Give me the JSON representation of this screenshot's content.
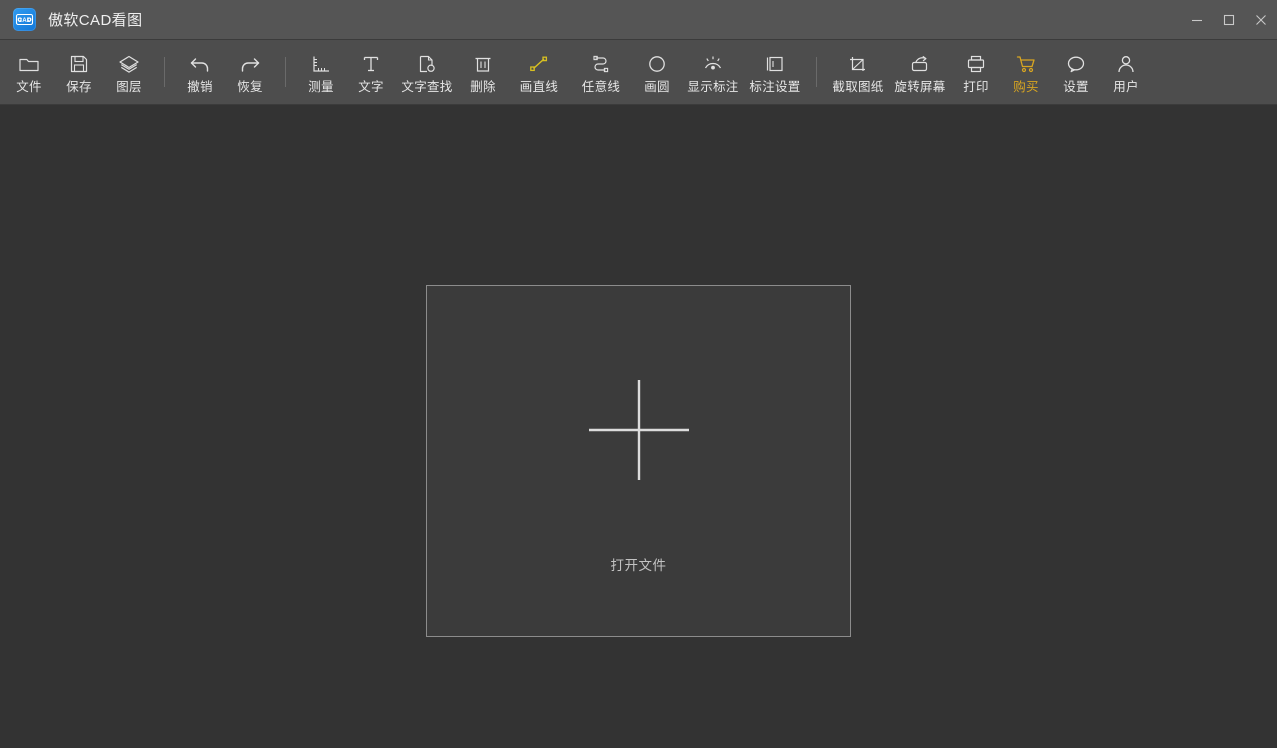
{
  "window": {
    "title": "傲软CAD看图",
    "logo_text": "CAD",
    "logo_icon": "cad-app-logo",
    "controls": [
      {
        "name": "minimize",
        "icon": "minimize-icon",
        "label": "−"
      },
      {
        "name": "maximize",
        "icon": "maximize-icon",
        "label": "□"
      },
      {
        "name": "close",
        "icon": "close-icon",
        "label": "×"
      }
    ]
  },
  "toolbar": {
    "items": [
      {
        "label": "文件",
        "icon": "folder-icon",
        "name": "file",
        "accent": false
      },
      {
        "label": "保存",
        "icon": "save-floppy-icon",
        "name": "save",
        "accent": false
      },
      {
        "label": "图层",
        "icon": "layers-icon",
        "name": "layers",
        "accent": false
      },
      {
        "sep": true
      },
      {
        "label": "撤销",
        "icon": "undo-arrow-icon",
        "name": "undo",
        "accent": false
      },
      {
        "label": "恢复",
        "icon": "redo-arrow-icon",
        "name": "redo",
        "accent": false
      },
      {
        "sep": true
      },
      {
        "label": "测量",
        "icon": "ruler-measure-icon",
        "name": "measure",
        "accent": false
      },
      {
        "label": "文字",
        "icon": "text-t-icon",
        "name": "text",
        "accent": false
      },
      {
        "label": "文字查找",
        "icon": "text-search-icon",
        "name": "text-find",
        "accent": false
      },
      {
        "label": "删除",
        "icon": "trash-icon",
        "name": "delete",
        "accent": false
      },
      {
        "label": "画直线",
        "icon": "draw-line-icon",
        "name": "draw-line",
        "accent": false
      },
      {
        "label": "任意线",
        "icon": "polyline-icon",
        "name": "draw-polyline",
        "accent": false
      },
      {
        "label": "画圆",
        "icon": "circle-icon",
        "name": "draw-circle",
        "accent": false
      },
      {
        "label": "显示标注",
        "icon": "show-annotation-icon",
        "name": "show-annotation",
        "accent": false
      },
      {
        "label": "标注设置",
        "icon": "annotation-settings-icon",
        "name": "annotation-settings",
        "accent": false
      },
      {
        "sep": true
      },
      {
        "label": "截取图纸",
        "icon": "crop-icon",
        "name": "capture-drawing",
        "accent": false
      },
      {
        "label": "旋转屏幕",
        "icon": "rotate-screen-icon",
        "name": "rotate-screen",
        "accent": false
      },
      {
        "label": "打印",
        "icon": "printer-icon",
        "name": "print",
        "accent": false
      },
      {
        "label": "购买",
        "icon": "shopping-cart-icon",
        "name": "purchase",
        "accent": true
      },
      {
        "label": "设置",
        "icon": "speech-bubble-icon",
        "name": "settings",
        "accent": false
      },
      {
        "label": "用户",
        "icon": "user-person-icon",
        "name": "user",
        "accent": false
      }
    ]
  },
  "canvas": {
    "dropzone": {
      "label": "打开文件",
      "plus_icon": "plus-icon"
    }
  },
  "colors": {
    "titlebar_bg": "#555555",
    "toolbar_bg": "#4d4d4d",
    "canvas_bg": "#333333",
    "dropzone_bg": "#3b3b3b",
    "dropzone_border": "#8c8c8c",
    "icon_stroke": "#e0e0e0",
    "accent_gold": "#d8a521",
    "line_yellow": "#d8c021",
    "logo_blue": "#1f86e8",
    "text_primary": "#f0f0f0",
    "text_muted": "#c2c2c2"
  }
}
